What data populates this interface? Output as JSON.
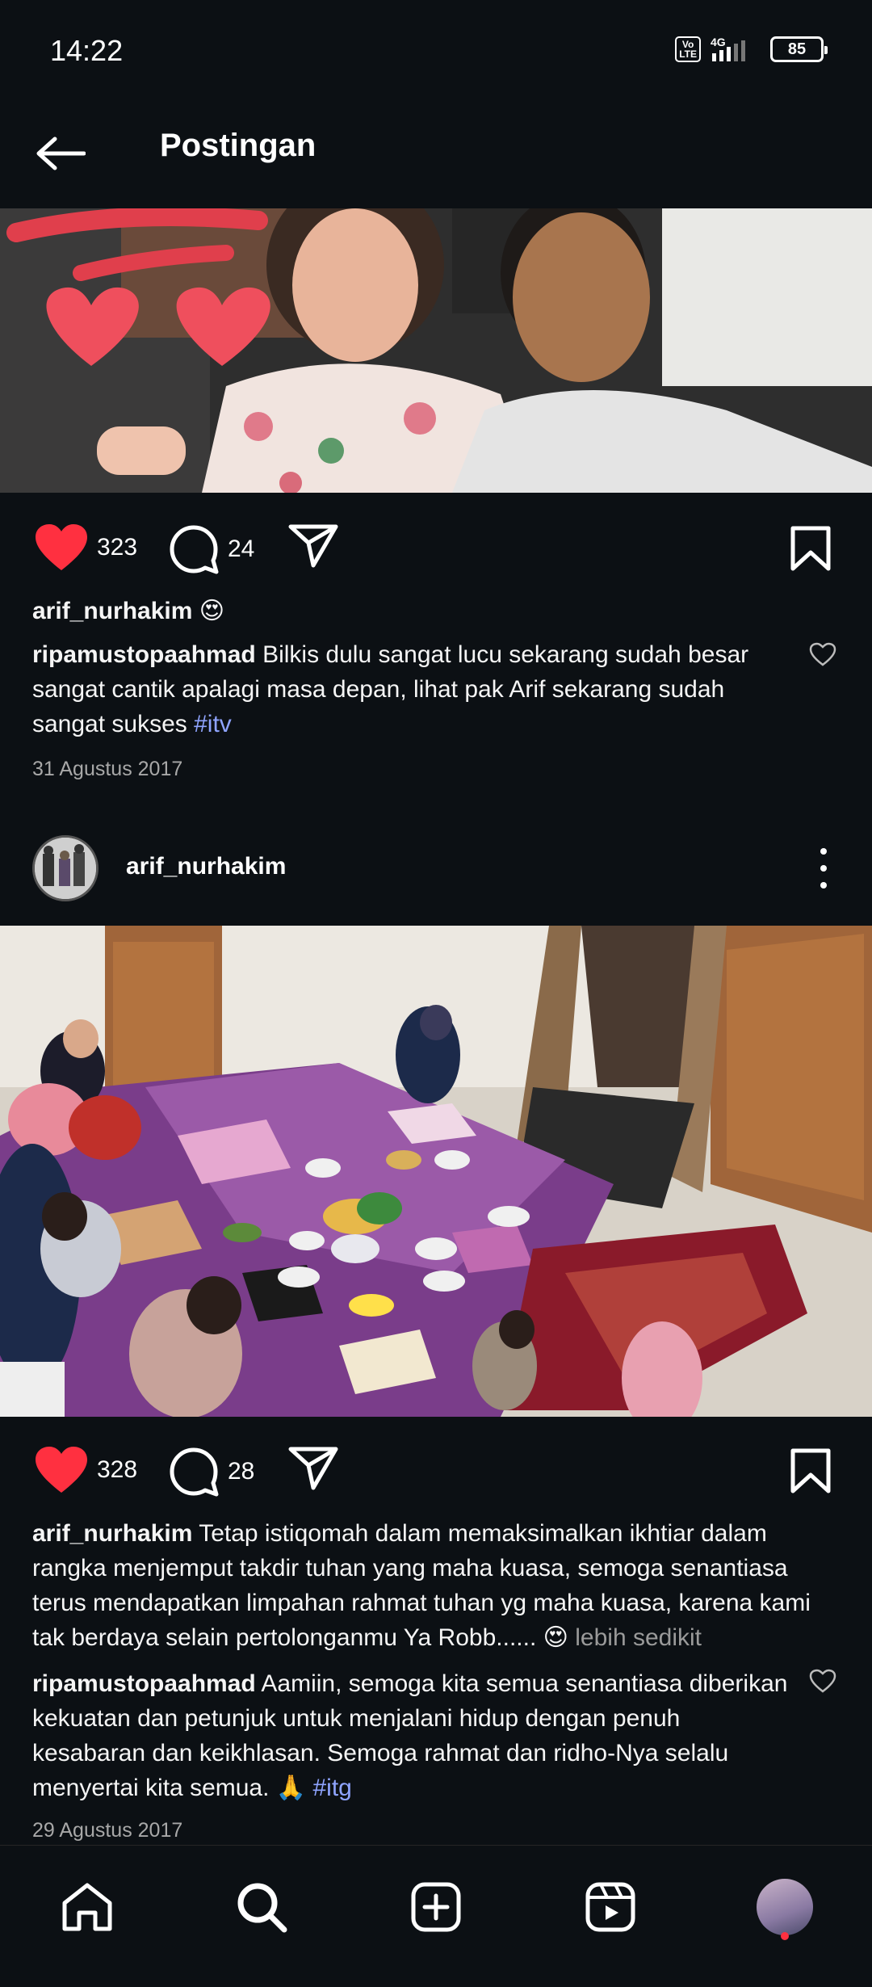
{
  "status_bar": {
    "time": "14:22",
    "volte": "Vo LTE",
    "network": "4G",
    "battery": "85"
  },
  "nav": {
    "title": "Postingan",
    "back_icon": "arrow-left-icon"
  },
  "posts": [
    {
      "likes": "323",
      "comments": "24",
      "caption_user": "arif_nurhakim",
      "caption_text": "😍",
      "comment_user": "ripamustopaahmad",
      "comment_text": "Bilkis dulu sangat lucu sekarang sudah besar sangat cantik apalagi masa depan, lihat pak Arif sekarang sudah sangat sukses",
      "comment_tag": "#itv",
      "date": "31 Agustus 2017"
    },
    {
      "username": "arif_nurhakim",
      "likes": "328",
      "comments": "28",
      "caption_user": "arif_nurhakim",
      "caption_text": "Tetap istiqomah dalam memaksimalkan ikhtiar dalam rangka menjemput takdir tuhan yang maha kuasa,  semoga senantiasa terus mendapatkan limpahan rahmat tuhan yg maha kuasa,  karena kami tak berdaya selain pertolonganmu Ya Robb...... 😍",
      "more_label": "lebih sedikit",
      "comment_user": "ripamustopaahmad",
      "comment_text": "Aamiin, semoga kita semua senantiasa diberikan kekuatan dan petunjuk untuk menjalani hidup dengan penuh kesabaran dan keikhlasan. Semoga rahmat dan ridho-Nya selalu menyertai kita semua. 🙏",
      "comment_tag": "#itg",
      "date": "29 Agustus 2017"
    }
  ],
  "bottom_nav": {
    "items": [
      "home-icon",
      "search-icon",
      "create-icon",
      "reels-icon",
      "profile-avatar"
    ]
  },
  "colors": {
    "background": "#0c1014",
    "like_red": "#ff3040",
    "hashtag": "#8fa4ff"
  }
}
